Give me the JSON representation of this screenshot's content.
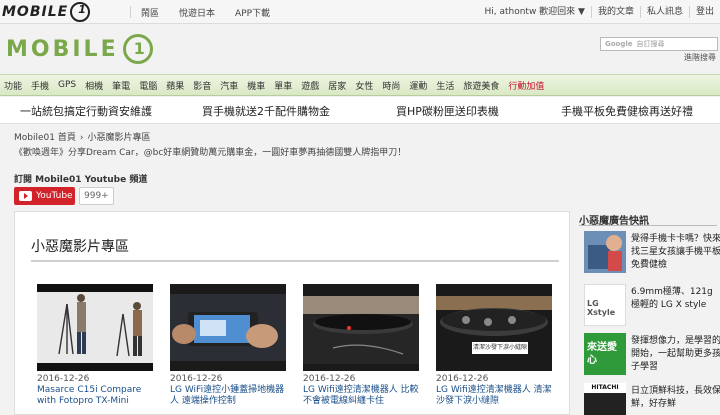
{
  "topbar": {
    "logo_word": "MOBILE",
    "logo_zero": "1",
    "nav": [
      "鬧區",
      "悅遊日本",
      "APP下載"
    ],
    "user_greeting": "Hi, athontw 歡迎回來 ▼",
    "right_links": [
      "我的文章",
      "私人訊息",
      "登出"
    ]
  },
  "header": {
    "logo_word": "MOBILE",
    "logo_zero": "1",
    "search_brand": "Google",
    "search_placeholder": "自訂搜尋",
    "advanced_search": "進階搜尋"
  },
  "category_nav": [
    {
      "label": "功能",
      "highlight": false
    },
    {
      "label": "手機",
      "highlight": false
    },
    {
      "label": "GPS",
      "highlight": false
    },
    {
      "label": "相機",
      "highlight": false
    },
    {
      "label": "筆電",
      "highlight": false
    },
    {
      "label": "電腦",
      "highlight": false
    },
    {
      "label": "蘋果",
      "highlight": false
    },
    {
      "label": "影音",
      "highlight": false
    },
    {
      "label": "汽車",
      "highlight": false
    },
    {
      "label": "機車",
      "highlight": false
    },
    {
      "label": "單車",
      "highlight": false
    },
    {
      "label": "遊戲",
      "highlight": false
    },
    {
      "label": "居家",
      "highlight": false
    },
    {
      "label": "女性",
      "highlight": false
    },
    {
      "label": "時尚",
      "highlight": false
    },
    {
      "label": "運動",
      "highlight": false
    },
    {
      "label": "生活",
      "highlight": false
    },
    {
      "label": "旅遊美食",
      "highlight": false
    },
    {
      "label": "行動加值",
      "highlight": true
    }
  ],
  "promo": [
    "一站統包搞定行動資安維護",
    "買手機就送2千配件購物金",
    "買HP碳粉匣送印表機",
    "手機平板免費健檢再送好禮"
  ],
  "breadcrumb": {
    "home": "Mobile01 首頁",
    "arrow": "›",
    "current": "小惡魔影片專區"
  },
  "notice": "《歡喚週年》分享Dream Car，@bc好車網贊助萬元購車金，一圓好車夢再抽德國雙人牌指甲刀！",
  "subscribe": {
    "title": "訂閱 Mobile01 Youtube 頻道",
    "button": "YouTube",
    "count": "999+"
  },
  "panel": {
    "heading": "小惡魔影片專區",
    "videos": [
      {
        "date": "2016-12-26",
        "title": "Masarce C15i Compare with Fotopro TX-Mini"
      },
      {
        "date": "2016-12-26",
        "title": "LG WiFi遠控小鍾蓋掃地機器人 遠端操作控制"
      },
      {
        "date": "2016-12-26",
        "title": "LG Wifi遠控清潔機器人 比較不會被電線糾纏卡住"
      },
      {
        "date": "2016-12-26",
        "title": "LG Wifi遠控清潔機器人 清潔沙發下淚小縫隙"
      }
    ],
    "video4_caption": "清潔沙發下淚小縫隙"
  },
  "sidebar": {
    "title": "小惡魔廣告快訊",
    "ads": [
      {
        "text": "覺得手機卡卡嗎？快來找三星女孩讓手機平板免費健檢",
        "brand": ""
      },
      {
        "text": "6.9mm極薄、121g極輕的 LG X style",
        "brand": "LG Xstyle"
      },
      {
        "text": "發揮想像力，是學習的開始，一起幫助更多孩子學習",
        "brand": "來送愛心"
      },
      {
        "text": "日立頂鮮科技，長效保鮮，好存鮮",
        "brand": "HITACHI"
      }
    ]
  }
}
